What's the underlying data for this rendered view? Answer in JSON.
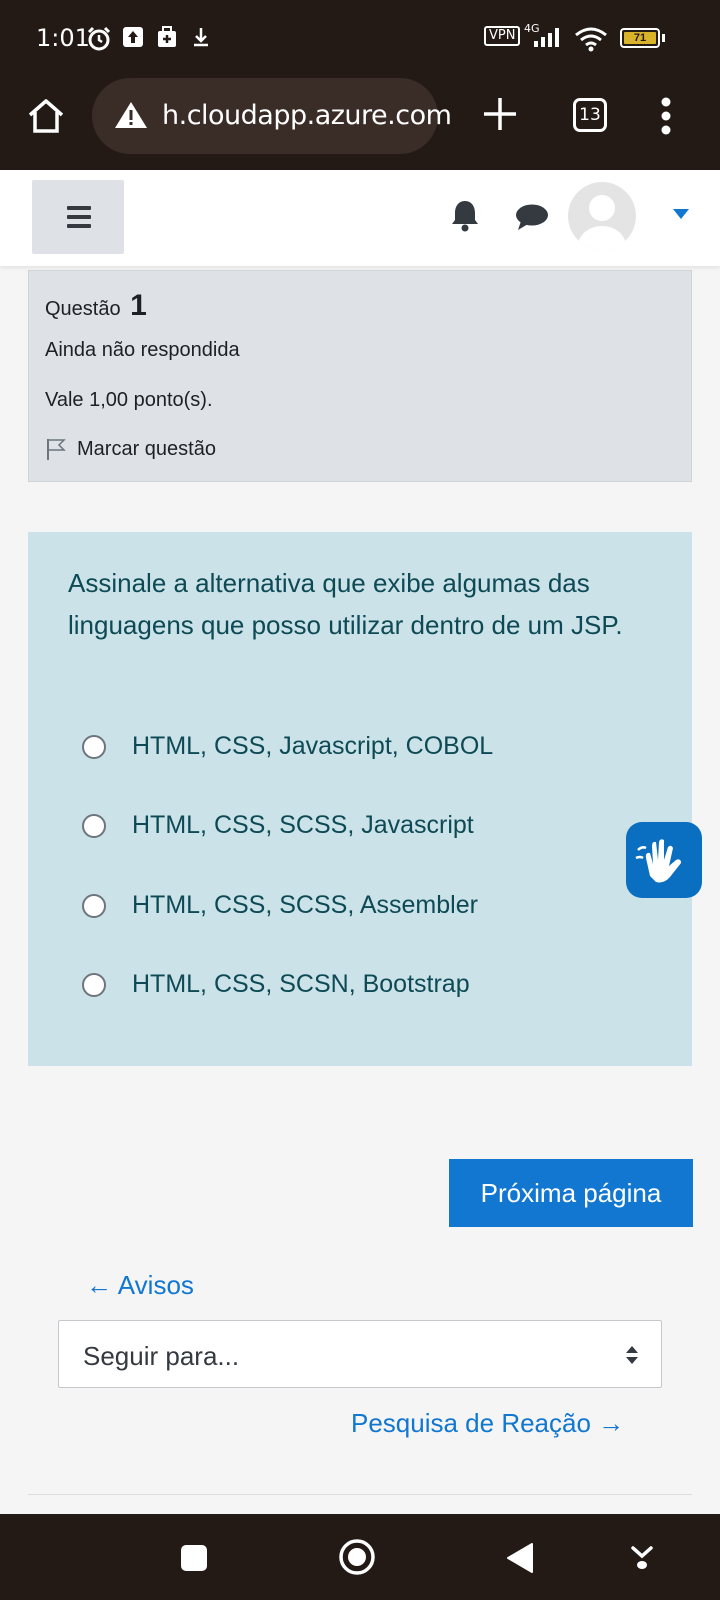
{
  "status_bar": {
    "time": "1:01",
    "vpn": "VPN",
    "network": "4G",
    "battery": "71"
  },
  "browser": {
    "url": "h.cloudapp.azure.com",
    "tab_count": "13"
  },
  "question": {
    "label": "Questão",
    "number": "1",
    "state": "Ainda não respondida",
    "grade": "Vale 1,00 ponto(s).",
    "flag_label": "Marcar questão",
    "text": "Assinale a alternativa que exibe algumas das linguagens que posso utilizar dentro de um JSP.",
    "answers": [
      "HTML, CSS, Javascript, COBOL",
      "HTML, CSS, SCSS, Javascript",
      "HTML, CSS, SCSS, Assembler",
      "HTML, CSS, SCSN, Bootstrap"
    ]
  },
  "navigation": {
    "next_button": "Próxima página",
    "prev_activity": "← Avisos",
    "jump_placeholder": "Seguir para...",
    "next_activity": "Pesquisa de Reação →"
  },
  "colors": {
    "accent": "#1177d1",
    "question_bg": "#cbe2e8",
    "info_bg": "#dee2e6",
    "system_bar": "#231a16"
  }
}
